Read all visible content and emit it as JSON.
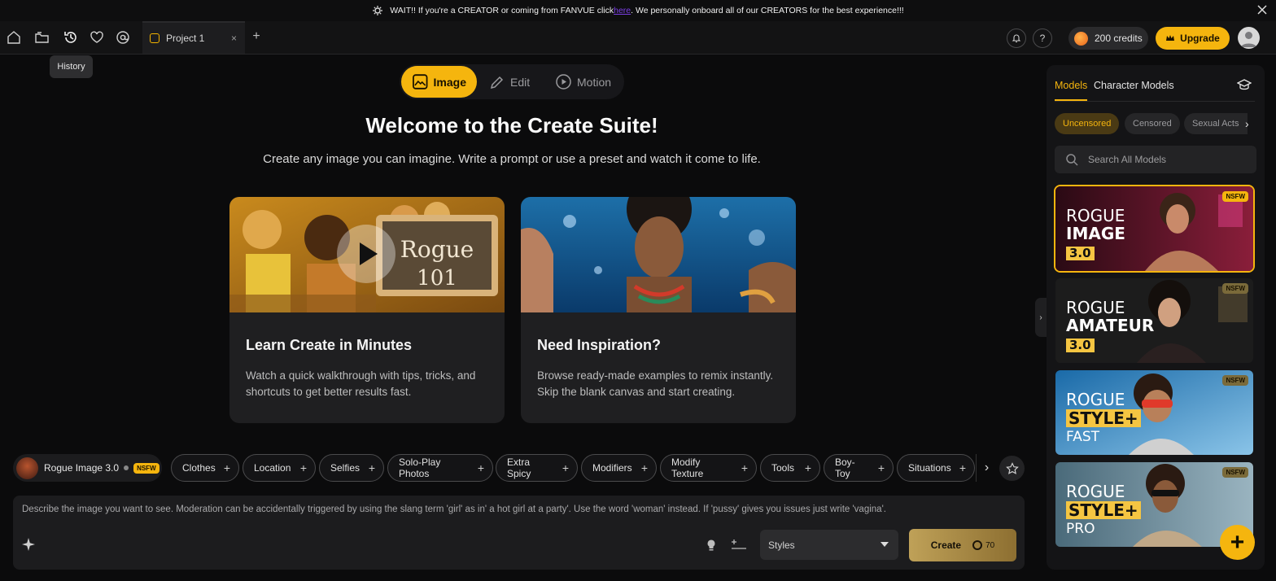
{
  "banner": {
    "text_before": "WAIT!! If you're a CREATOR or coming from FANVUE click ",
    "link": "here",
    "text_after": ". We personally onboard all of our CREATORS for the best experience!!!"
  },
  "topbar": {
    "tab_title": "Project 1",
    "tab_close": "×",
    "add_tab": "+",
    "help": "?",
    "credits": "200 credits",
    "upgrade": "Upgrade",
    "tooltip": "History"
  },
  "modes": [
    {
      "label": "Image",
      "icon": "image-icon",
      "active": true
    },
    {
      "label": "Edit",
      "icon": "pencil-icon",
      "active": false
    },
    {
      "label": "Motion",
      "icon": "play-circle-icon",
      "active": false
    }
  ],
  "hero": {
    "title": "Welcome to the Create Suite!",
    "subtitle": "Create any image you can imagine. Write a prompt or use a preset and watch it come to life."
  },
  "cards": [
    {
      "title": "Learn Create in Minutes",
      "desc": "Watch a quick walkthrough with tips, tricks, and shortcuts to get better results fast.",
      "chalkboard_1": "Rogue",
      "chalkboard_2": "101"
    },
    {
      "title": "Need Inspiration?",
      "desc": "Browse ready-made examples to remix instantly. Skip the blank canvas and start creating."
    }
  ],
  "model_chip": {
    "name": "Rogue Image 3.0",
    "badge": "NSFW"
  },
  "chips": [
    "Clothes",
    "Location",
    "Selfies",
    "Solo-Play Photos",
    "Extra Spicy",
    "Modifiers",
    "Modify Texture",
    "Tools",
    "Boy-Toy",
    "Situations"
  ],
  "chips_next": "›",
  "prompt": {
    "placeholder": "Describe the image you want to see. Moderation can be accidentally triggered by using the slang term 'girl' as in' a hot girl at a party'. Use the word 'woman' instead. If 'pussy' gives you issues just write 'vagina'."
  },
  "styles_select": "Styles",
  "create": {
    "label": "Create",
    "cost": "70"
  },
  "panel": {
    "tabs": [
      "Models",
      "Character Models"
    ],
    "filters": [
      "Uncensored",
      "Censored",
      "Sexual Acts"
    ],
    "filters_next": "›",
    "search_placeholder": "Search All Models",
    "models": [
      {
        "line1": "ROGUE",
        "line2": "IMAGE",
        "line3": "3.0",
        "badge": "NSFW"
      },
      {
        "line1": "ROGUE",
        "line2": "AMATEUR",
        "line3": "3.0",
        "badge": "NSFW"
      },
      {
        "line1": "ROGUE",
        "line2": "STYLE+",
        "line3": "FAST",
        "badge": "NSFW"
      },
      {
        "line1": "ROGUE",
        "line2": "STYLE+",
        "line3": "PRO",
        "badge": "NSFW"
      }
    ],
    "collapse": "›",
    "fab": "+"
  },
  "colors": {
    "accent": "#f5b50e",
    "background": "#0b0b0c",
    "panel": "#141416",
    "card": "#1f1f21"
  }
}
